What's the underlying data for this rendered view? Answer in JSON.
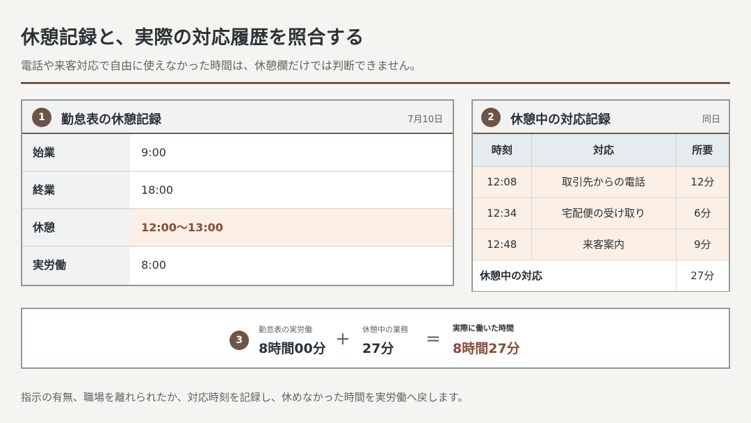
{
  "header": {
    "title": "休憩記録と、実際の対応履歴を照合する",
    "subtitle": "電話や来客対応で自由に使えなかった時間は、休憩欄だけでは判断できません。"
  },
  "panel1": {
    "badge": "1",
    "title": "勤怠表の休憩記録",
    "date": "7月10日",
    "rows": [
      {
        "label": "始業",
        "value": "9:00"
      },
      {
        "label": "終業",
        "value": "18:00"
      },
      {
        "label": "休憩",
        "value": "12:00〜13:00"
      },
      {
        "label": "実労働",
        "value": "8:00"
      }
    ]
  },
  "panel2": {
    "badge": "2",
    "title": "休憩中の対応記録",
    "date": "同日",
    "columns": [
      "時刻",
      "対応",
      "所要"
    ],
    "rows": [
      {
        "time": "12:08",
        "task": "取引先からの電話",
        "duration": "12分"
      },
      {
        "time": "12:34",
        "task": "宅配便の受け取り",
        "duration": "6分"
      },
      {
        "time": "12:48",
        "task": "来客案内",
        "duration": "9分"
      }
    ],
    "total_label": "休憩中の対応",
    "total_value": "27分"
  },
  "summary": {
    "badge": "3",
    "term1_caption": "勤怠表の実労働",
    "term1_value": "8時間00分",
    "plus": "+",
    "term2_caption": "休憩中の業務",
    "term2_value": "27分",
    "equals": "=",
    "result_caption": "実際に働いた時間",
    "result_value": "8時間27分"
  },
  "footer": {
    "note": "指示の有無、職場を離れられたか、対応時刻を記録し、休めなかった時間を実労働へ戻します。"
  },
  "colors": {
    "accent": "#6e5446",
    "highlight": "#fcefe6",
    "result_text": "#8a4a36"
  }
}
